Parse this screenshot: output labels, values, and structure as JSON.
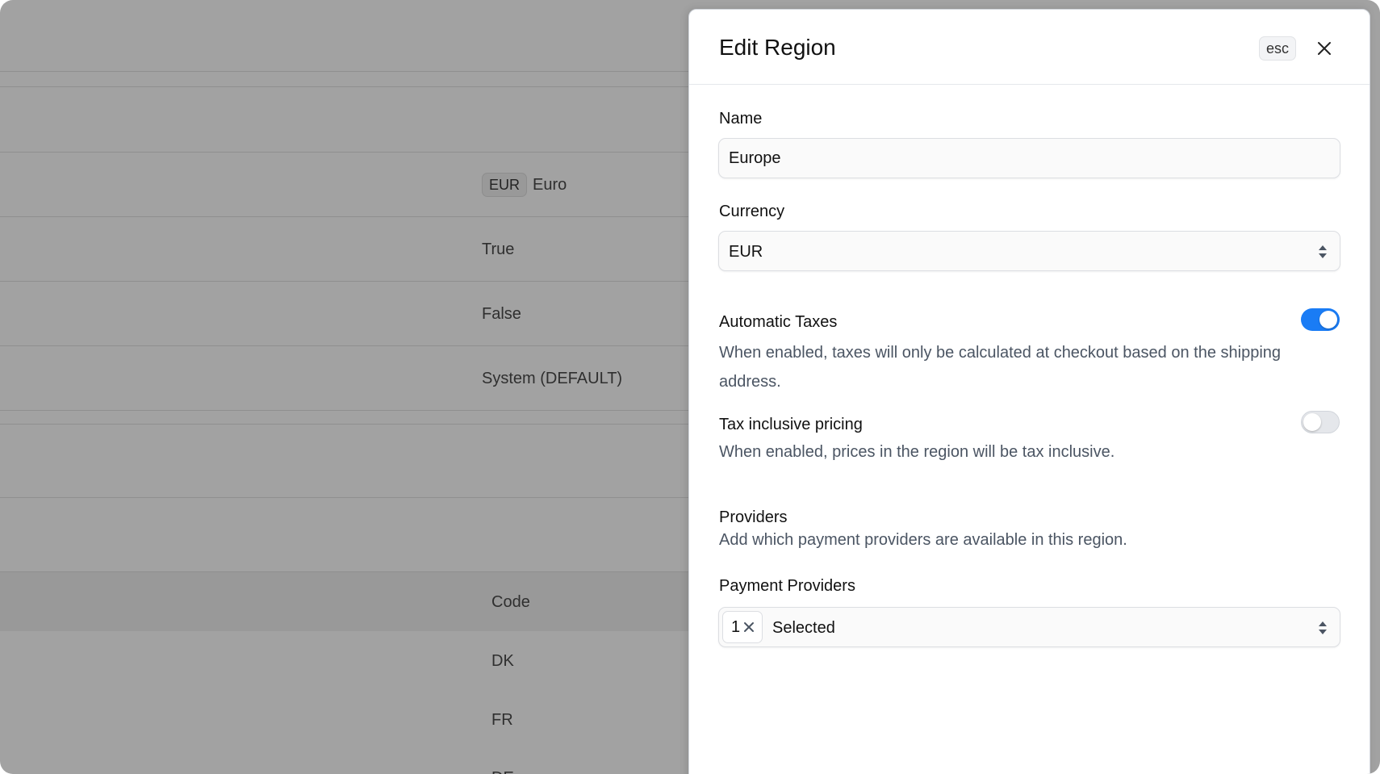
{
  "background": {
    "currency": {
      "code": "EUR",
      "name": "Euro"
    },
    "rows": [
      "True",
      "False",
      "System (DEFAULT)"
    ],
    "table": {
      "header": "Code",
      "rows": [
        "DK",
        "FR",
        "DE"
      ]
    }
  },
  "drawer": {
    "title": "Edit Region",
    "esc_label": "esc",
    "name": {
      "label": "Name",
      "value": "Europe"
    },
    "currency": {
      "label": "Currency",
      "value": "EUR"
    },
    "automatic_taxes": {
      "label": "Automatic Taxes",
      "hint": "When enabled, taxes will only be calculated at checkout based on the shipping address.",
      "enabled": true
    },
    "tax_inclusive": {
      "label": "Tax inclusive pricing",
      "hint": "When enabled, prices in the region will be tax inclusive.",
      "enabled": false
    },
    "providers": {
      "heading": "Providers",
      "hint": "Add which payment providers are available in this region."
    },
    "payment_providers": {
      "label": "Payment Providers",
      "count": "1",
      "value": "Selected"
    }
  },
  "colors": {
    "accent": "#1a7cf5",
    "overlay": "#a2a2a2"
  },
  "icons": {
    "close": "close-icon",
    "select_arrows": "chevron-up-down-icon",
    "remove": "x-icon"
  }
}
